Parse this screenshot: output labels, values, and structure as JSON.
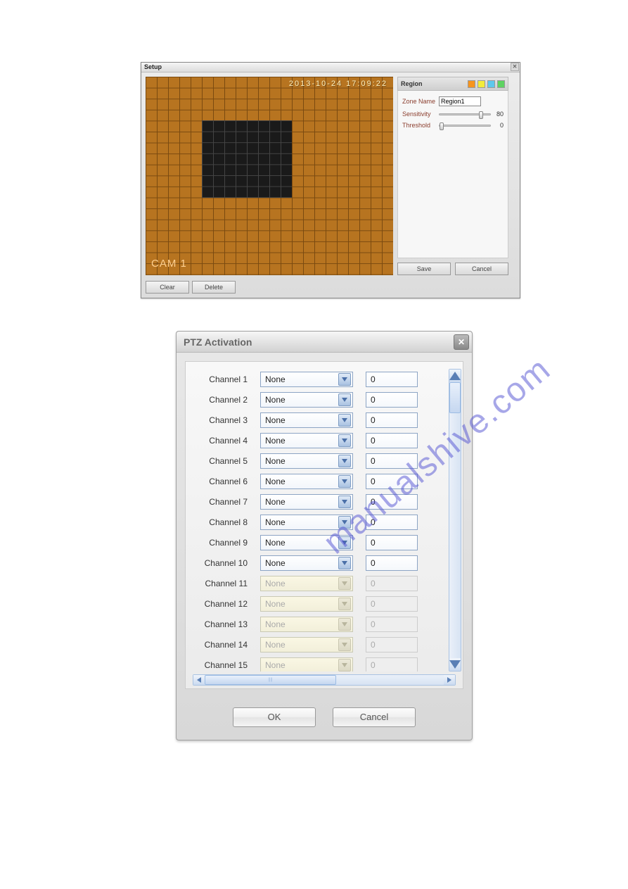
{
  "watermark": "manualshive.com",
  "setup": {
    "title": "Setup",
    "timestamp": "2013-10-24 17:09:22",
    "cam_label": "CAM 1",
    "clear_label": "Clear",
    "delete_label": "Delete",
    "region_header": "Region",
    "swatches": [
      "#f7941d",
      "#f3ec3a",
      "#5ec8ed",
      "#5ed362"
    ],
    "zone_name_label": "Zone Name",
    "zone_name_value": "Region1",
    "sensitivity_label": "Sensitivity",
    "sensitivity_value": "80",
    "threshold_label": "Threshold",
    "threshold_value": "0",
    "save_label": "Save",
    "cancel_label": "Cancel"
  },
  "ptz": {
    "title": "PTZ Activation",
    "ok_label": "OK",
    "cancel_label": "Cancel",
    "rows": [
      {
        "label": "Channel 1",
        "option": "None",
        "value": "0",
        "enabled": true
      },
      {
        "label": "Channel 2",
        "option": "None",
        "value": "0",
        "enabled": true
      },
      {
        "label": "Channel 3",
        "option": "None",
        "value": "0",
        "enabled": true
      },
      {
        "label": "Channel 4",
        "option": "None",
        "value": "0",
        "enabled": true
      },
      {
        "label": "Channel 5",
        "option": "None",
        "value": "0",
        "enabled": true
      },
      {
        "label": "Channel 6",
        "option": "None",
        "value": "0",
        "enabled": true
      },
      {
        "label": "Channel 7",
        "option": "None",
        "value": "0",
        "enabled": true
      },
      {
        "label": "Channel 8",
        "option": "None",
        "value": "0",
        "enabled": true
      },
      {
        "label": "Channel 9",
        "option": "None",
        "value": "0",
        "enabled": true
      },
      {
        "label": "Channel 10",
        "option": "None",
        "value": "0",
        "enabled": true
      },
      {
        "label": "Channel 11",
        "option": "None",
        "value": "0",
        "enabled": false
      },
      {
        "label": "Channel 12",
        "option": "None",
        "value": "0",
        "enabled": false
      },
      {
        "label": "Channel 13",
        "option": "None",
        "value": "0",
        "enabled": false
      },
      {
        "label": "Channel 14",
        "option": "None",
        "value": "0",
        "enabled": false
      },
      {
        "label": "Channel 15",
        "option": "None",
        "value": "0",
        "enabled": false
      }
    ]
  }
}
